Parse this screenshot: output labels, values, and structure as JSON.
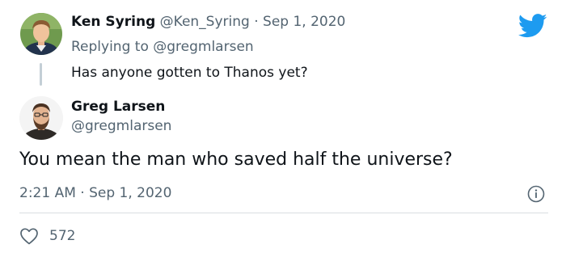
{
  "quoted_tweet": {
    "author_name": "Ken Syring",
    "author_handle": "@Ken_Syring",
    "separator": "·",
    "date": "Sep 1, 2020",
    "replying_to": "Replying to @gregmlarsen",
    "text": "Has anyone gotten to Thanos yet?"
  },
  "reply_tweet": {
    "author_name": "Greg Larsen",
    "author_handle": "@gregmlarsen",
    "text": "You mean the man who saved half the universe?",
    "timestamp": "2:21 AM · Sep 1, 2020",
    "likes": "572"
  },
  "icons": {
    "brand": "twitter-bird-icon",
    "info": "info-icon",
    "like": "heart-icon"
  },
  "colors": {
    "brand_blue": "#1d9bf0",
    "text": "#0f1419",
    "muted": "#536471",
    "thread_line": "#c4cfd6",
    "divider": "#d9dee2"
  }
}
